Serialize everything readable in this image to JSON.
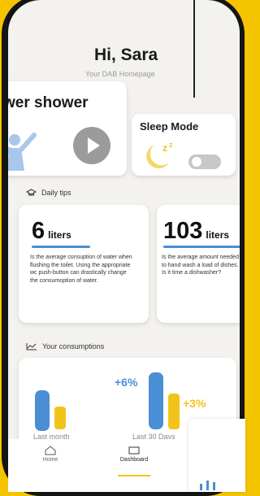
{
  "header": {
    "greeting": "Hi, Sara",
    "subtitle": "Your DAB Homepage"
  },
  "shower_card": {
    "title": "wer shower",
    "play_icon": "play-icon",
    "person_icon": "person-icon"
  },
  "sleep_card": {
    "title": "Sleep Mode",
    "toggle_state": "off",
    "moon_icon": "moon-icon"
  },
  "tips": {
    "heading": "Daily tips",
    "icon": "graduation-cap-icon",
    "items": [
      {
        "value": "6",
        "unit": "liters",
        "text": "Is the average consuption of water when flushing the toilet. Using the appropriate wc push-button can drastically change the consumoption of water."
      },
      {
        "value": "103",
        "unit": "liters",
        "text": "Is the average amount needed to hand wash a load of dishes. Is it time a dishwasher?"
      }
    ]
  },
  "consumptions": {
    "heading": "Your consumptions",
    "icon": "line-chart-icon",
    "last_month_label": "Last month",
    "last30_label": "Last 30 Days",
    "water_change": "+6%",
    "energy_change": "+3%"
  },
  "nav": {
    "items": [
      {
        "label": "Home",
        "icon": "home-icon"
      },
      {
        "label": "Dashboard",
        "icon": "dashboard-icon"
      }
    ],
    "active": "Dashboard"
  },
  "colors": {
    "accent_yellow": "#f2c419",
    "water_blue": "#4a8ed6"
  }
}
